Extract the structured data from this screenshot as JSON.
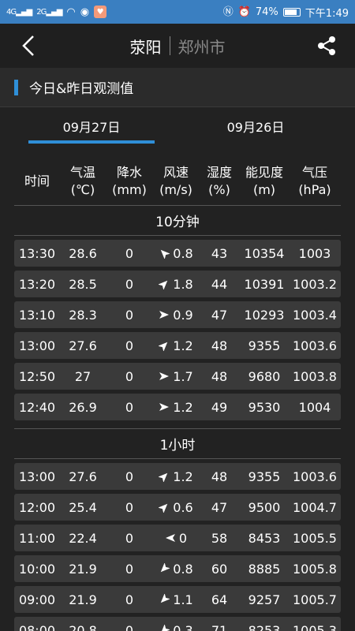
{
  "status_bar": {
    "signal1": "4G",
    "signal2": "2G",
    "battery_percent": "74%",
    "time": "下午1:49"
  },
  "header": {
    "city": "荥阳",
    "region": "郑州市"
  },
  "section": {
    "title": "今日&昨日观测值"
  },
  "tabs": [
    {
      "label": "09月27日",
      "selected": true
    },
    {
      "label": "09月26日",
      "selected": false
    }
  ],
  "columns": [
    {
      "line1": "时间",
      "line2": ""
    },
    {
      "line1": "气温",
      "line2": "(℃)"
    },
    {
      "line1": "降水",
      "line2": "(mm)"
    },
    {
      "line1": "风速",
      "line2": "(m/s)"
    },
    {
      "line1": "湿度",
      "line2": "(%)"
    },
    {
      "line1": "能见度",
      "line2": "(m)"
    },
    {
      "line1": "气压",
      "line2": "(hPa)"
    }
  ],
  "groups": [
    {
      "label": "10分钟",
      "rows": [
        {
          "time": "13:30",
          "temp": "28.6",
          "rain": "0",
          "wind": "0.8",
          "wind_dir": "nw-arrow",
          "hum": "43",
          "vis": "10354",
          "pres": "1003"
        },
        {
          "time": "13:20",
          "temp": "28.5",
          "rain": "0",
          "wind": "1.8",
          "wind_dir": "ne-arrow",
          "hum": "44",
          "vis": "10391",
          "pres": "1003.2"
        },
        {
          "time": "13:10",
          "temp": "28.3",
          "rain": "0",
          "wind": "0.9",
          "wind_dir": "e-arrow",
          "hum": "47",
          "vis": "10293",
          "pres": "1003.4"
        },
        {
          "time": "13:00",
          "temp": "27.6",
          "rain": "0",
          "wind": "1.2",
          "wind_dir": "ne-arrow",
          "hum": "48",
          "vis": "9355",
          "pres": "1003.6"
        },
        {
          "time": "12:50",
          "temp": "27",
          "rain": "0",
          "wind": "1.7",
          "wind_dir": "e-arrow",
          "hum": "48",
          "vis": "9680",
          "pres": "1003.8"
        },
        {
          "time": "12:40",
          "temp": "26.9",
          "rain": "0",
          "wind": "1.2",
          "wind_dir": "e-arrow",
          "hum": "49",
          "vis": "9530",
          "pres": "1004"
        }
      ]
    },
    {
      "label": "1小时",
      "rows": [
        {
          "time": "13:00",
          "temp": "27.6",
          "rain": "0",
          "wind": "1.2",
          "wind_dir": "ne-arrow",
          "hum": "48",
          "vis": "9355",
          "pres": "1003.6"
        },
        {
          "time": "12:00",
          "temp": "25.4",
          "rain": "0",
          "wind": "0.6",
          "wind_dir": "ne-arrow",
          "hum": "47",
          "vis": "9500",
          "pres": "1004.7"
        },
        {
          "time": "11:00",
          "temp": "22.4",
          "rain": "0",
          "wind": "0",
          "wind_dir": "w-arrow",
          "hum": "58",
          "vis": "8453",
          "pres": "1005.5"
        },
        {
          "time": "10:00",
          "temp": "21.9",
          "rain": "0",
          "wind": "0.8",
          "wind_dir": "sw-arrow",
          "hum": "60",
          "vis": "8885",
          "pres": "1005.8"
        },
        {
          "time": "09:00",
          "temp": "21.9",
          "rain": "0",
          "wind": "1.1",
          "wind_dir": "sw-arrow",
          "hum": "64",
          "vis": "9257",
          "pres": "1005.7"
        },
        {
          "time": "08:00",
          "temp": "20.8",
          "rain": "0",
          "wind": "0.3",
          "wind_dir": "sw-arrow",
          "hum": "71",
          "vis": "8253",
          "pres": "1005.3"
        }
      ]
    }
  ]
}
